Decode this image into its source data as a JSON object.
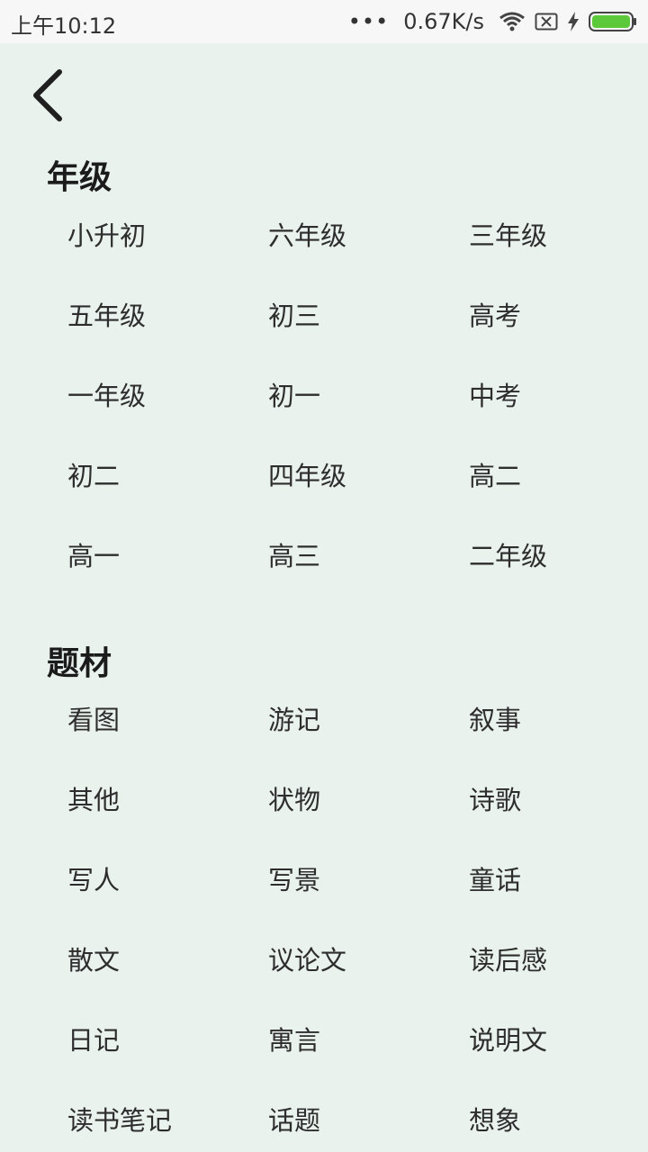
{
  "status_bar": {
    "time": "上午10:12",
    "dots": "•••",
    "speed": "0.67K/s",
    "battery_color": "#5cc93a"
  },
  "icons": {
    "back": "back-arrow-icon",
    "wifi": "wifi-icon",
    "sim": "no-sim-icon",
    "charging": "charging-bolt-icon",
    "battery": "battery-icon"
  },
  "grade": {
    "title": "年级",
    "items": [
      "小升初",
      "六年级",
      "三年级",
      "五年级",
      "初三",
      "高考",
      "一年级",
      "初一",
      "中考",
      "初二",
      "四年级",
      "高二",
      "高一",
      "高三",
      "二年级"
    ]
  },
  "theme": {
    "title": "题材",
    "items": [
      "看图",
      "游记",
      "叙事",
      "其他",
      "状物",
      "诗歌",
      "写人",
      "写景",
      "童话",
      "散文",
      "议论文",
      "读后感",
      "日记",
      "寓言",
      "说明文",
      "读书笔记",
      "话题",
      "想象"
    ]
  }
}
